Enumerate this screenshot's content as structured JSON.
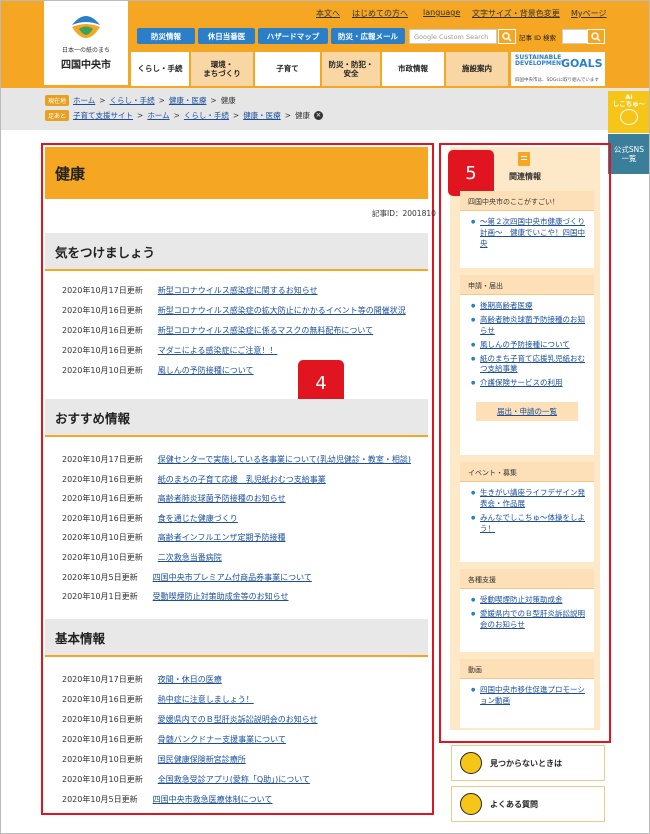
{
  "header": {
    "logo_tagline": "日本一の紙のまち",
    "logo_name": "四国中央市",
    "util_links": [
      "本文へ",
      "はじめての方へ",
      "language",
      "文字サイズ・背景色変更",
      "Myページ"
    ],
    "quick_buttons": [
      "防災情報",
      "休日当番医",
      "ハザードマップ",
      "防災・広報メール"
    ],
    "search_placeholder": "Google Custom Search",
    "id_search_label": "記事 ID 検索",
    "nav": [
      "くらし・手続",
      "環境・\nまちづくり",
      "子育て",
      "防災・防犯・\n安全",
      "市政情報",
      "施設案内"
    ],
    "sdg_title": "SUSTAINABLE\nDEVELOPMENT",
    "sdg_goals": "GOALS",
    "sdg_sub": "四国中央市は、SDGsに取り組んでいます"
  },
  "breadcrumbs": {
    "tag1": "現在地",
    "path1": [
      "ホーム",
      "くらし・手続",
      "健康・医療",
      "健康"
    ],
    "tag2": "足あと",
    "path2": [
      "子育て支援サイト",
      "ホーム",
      "くらし・手続",
      "健康・医療",
      "健康"
    ]
  },
  "side_tabs": {
    "ai_label": "AI\nしこちゅ～",
    "sns_label": "公式SNS\n一覧"
  },
  "main": {
    "title": "健康",
    "page_id": "記事ID：2001810",
    "badge": "4",
    "sections": [
      {
        "heading": "気をつけましょう",
        "items": [
          {
            "date": "2020年10月17日更新",
            "title": "新型コロナウイルス感染症に関するお知らせ"
          },
          {
            "date": "2020年10月16日更新",
            "title": "新型コロナウイルス感染症の拡大防止にかかるイベント等の開催状況"
          },
          {
            "date": "2020年10月16日更新",
            "title": "新型コロナウイルス感染症に係るマスクの無料配布について"
          },
          {
            "date": "2020年10月16日更新",
            "title": "マダニによる感染症にご注意！！"
          },
          {
            "date": "2020年10月10日更新",
            "title": "風しんの予防接種について"
          }
        ]
      },
      {
        "heading": "おすすめ情報",
        "items": [
          {
            "date": "2020年10月17日更新",
            "title": "保健センターで実施している各事業について(乳幼児健診・教室・相談)"
          },
          {
            "date": "2020年10月16日更新",
            "title": "紙のまちの子育て応援　乳児紙おむつ支給事業"
          },
          {
            "date": "2020年10月16日更新",
            "title": "高齢者肺炎球菌予防接種のお知らせ"
          },
          {
            "date": "2020年10月16日更新",
            "title": "食を通じた健康づくり"
          },
          {
            "date": "2020年10月10日更新",
            "title": "高齢者インフルエンザ定期予防接種"
          },
          {
            "date": "2020年10月10日更新",
            "title": "二次救急当番病院"
          },
          {
            "date": "2020年10月5日更新",
            "title": "四国中央市プレミアム付商品券事業について"
          },
          {
            "date": "2020年10月1日更新",
            "title": "受動喫煙防止対策助成金等のお知らせ"
          }
        ]
      },
      {
        "heading": "基本情報",
        "items": [
          {
            "date": "2020年10月17日更新",
            "title": "夜間・休日の医療"
          },
          {
            "date": "2020年10月16日更新",
            "title": "熱中症に注意しましょう！"
          },
          {
            "date": "2020年10月16日更新",
            "title": "愛媛県内でのＢ型肝炎訴訟説明会のお知らせ"
          },
          {
            "date": "2020年10月16日更新",
            "title": "骨髄バンクドナー支援事業について"
          },
          {
            "date": "2020年10月10日更新",
            "title": "国民健康保険新宮診療所"
          },
          {
            "date": "2020年10月10日更新",
            "title": "全国救急受診アプリ(愛称「Q助」)について"
          },
          {
            "date": "2020年10月5日更新",
            "title": "四国中央市救急医療体制について"
          }
        ]
      }
    ]
  },
  "sidebar": {
    "badge": "5",
    "heading": "関連情報",
    "groups": [
      {
        "heading": "四国中央市のここがすごい！",
        "items": [
          "～第２次四国中央市健康づくり計画～　健康でいこや！四国中央"
        ]
      },
      {
        "heading": "申請・届出",
        "items": [
          "後期高齢者医療",
          "高齢者肺炎球菌予防接種のお知らせ",
          "風しんの予防接種について",
          "紙のまち子育て応援乳児紙おむつ支給事業",
          "介護保険サービスの利用"
        ],
        "more": "届出・申請の一覧"
      },
      {
        "heading": "イベント・募集",
        "items": [
          "生きがい講座ライフデザイン発表会・作品展",
          "みんなでしこちゅ〜体操をしよう！"
        ]
      },
      {
        "heading": "各種支援",
        "items": [
          "受動喫煙防止対策助成金",
          "愛媛県内でのＢ型肝炎訴訟説明会のお知らせ"
        ]
      },
      {
        "heading": "動画",
        "items": [
          "四国中央市移住促進プロモーション動画"
        ]
      }
    ],
    "help_links": [
      "見つからないときは",
      "よくある質問"
    ]
  },
  "colors": {
    "accent": "#f5a623",
    "link": "#1a4f9c",
    "annotation": "#e0151f",
    "button_blue": "#2a7fc8"
  }
}
